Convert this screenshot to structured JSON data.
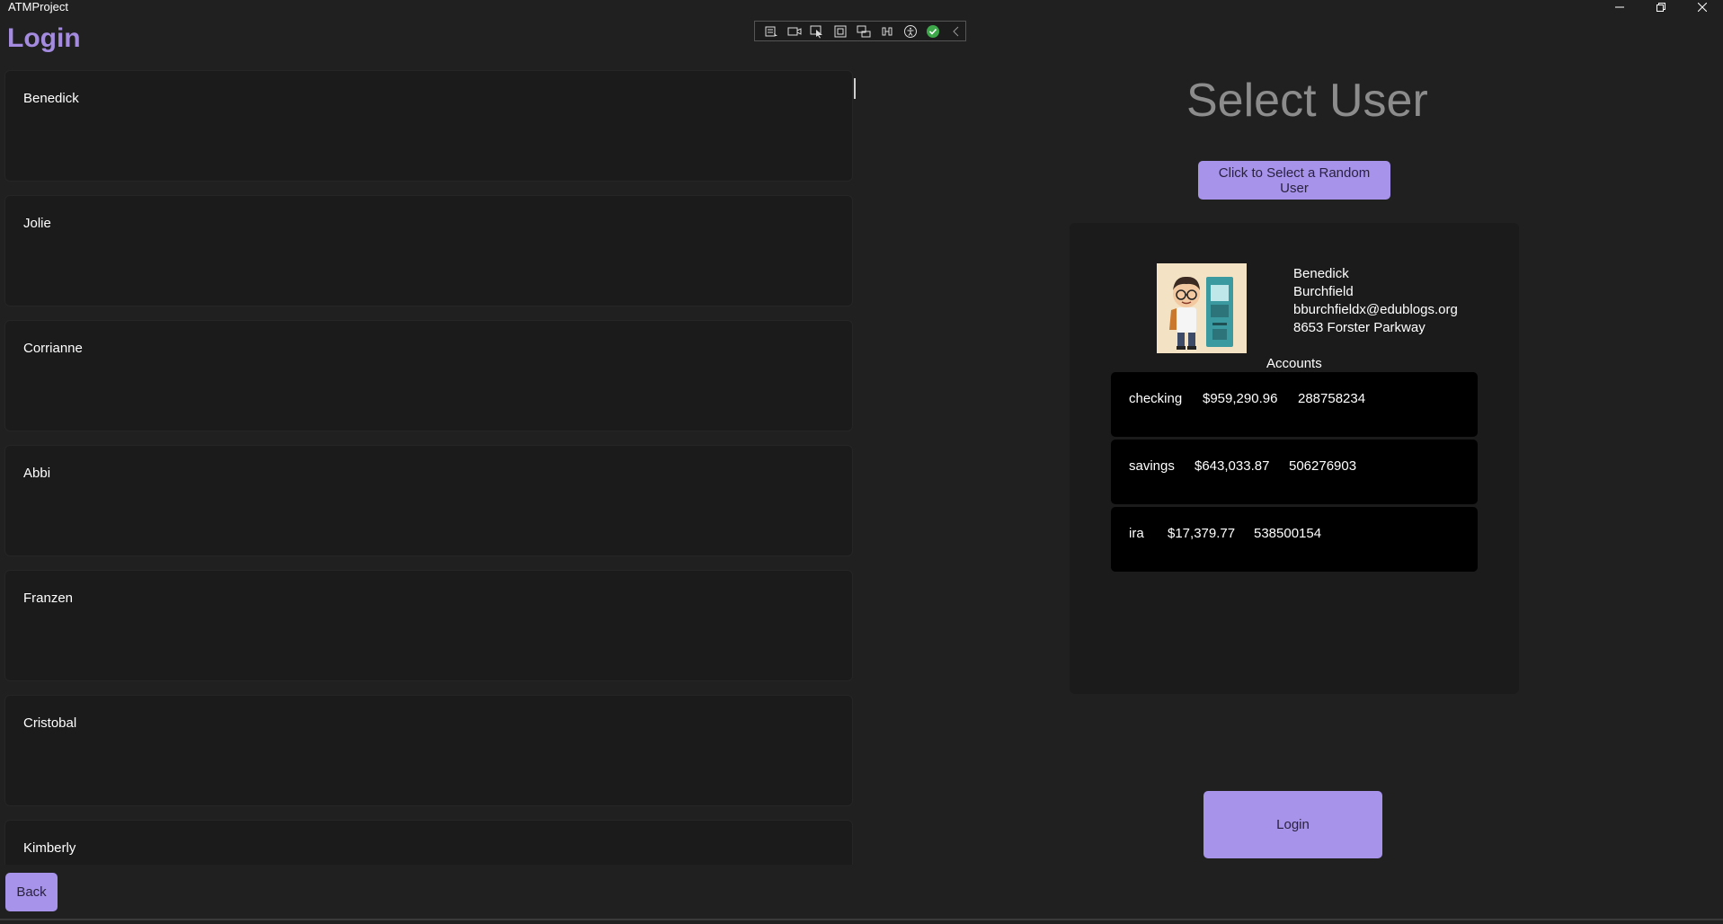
{
  "window": {
    "title": "ATMProject"
  },
  "page": {
    "title": "Login"
  },
  "toolbar": {
    "icons": [
      "live-visual-tree-icon",
      "camera-icon",
      "select-element-icon",
      "display-layout-adorners-icon",
      "track-focus-icon",
      "binding-failures-icon",
      "accessibility-icon",
      "checkmark-icon",
      "collapse-chevron-icon"
    ]
  },
  "users": [
    "Benedick",
    "Jolie",
    "Corrianne",
    "Abbi",
    "Franzen",
    "Cristobal",
    "Kimberly"
  ],
  "select_user": {
    "title": "Select User",
    "random_button": "Click to Select a Random User"
  },
  "selected_user": {
    "first_name": "Benedick",
    "last_name": "Burchfield",
    "email": "bburchfieldx@edublogs.org",
    "address": "8653 Forster Parkway",
    "accounts_heading": "Accounts",
    "accounts": [
      {
        "type": "checking",
        "balance": "$959,290.96",
        "number": "288758234"
      },
      {
        "type": "savings",
        "balance": "$643,033.87",
        "number": "506276903"
      },
      {
        "type": "ira",
        "balance": "$17,379.77",
        "number": "538500154"
      }
    ]
  },
  "buttons": {
    "login": "Login",
    "back": "Back"
  },
  "colors": {
    "accent": "#a48be0",
    "button": "#a794ea",
    "background": "#202020",
    "card": "#1b1b1b"
  }
}
